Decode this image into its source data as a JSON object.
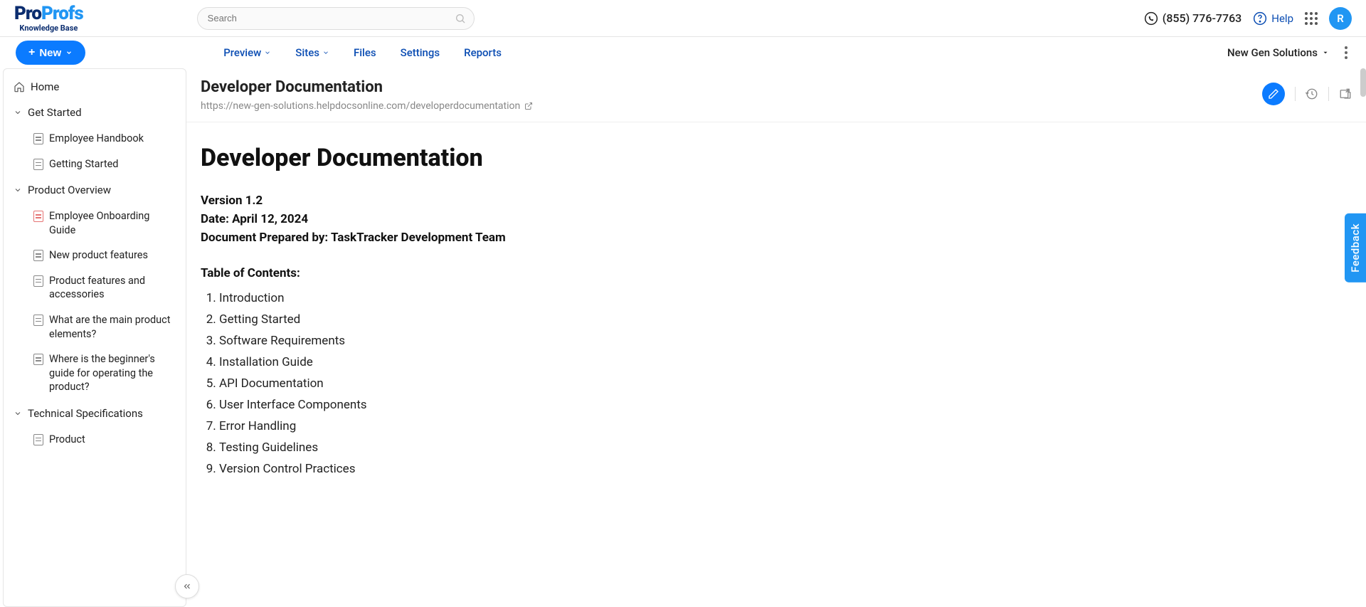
{
  "header": {
    "logo_pro": "Pro",
    "logo_profs": "Profs",
    "logo_sub": "Knowledge Base",
    "search_placeholder": "Search",
    "phone": "(855) 776-7763",
    "help": "Help",
    "avatar_initial": "R"
  },
  "subbar": {
    "new_label": "New",
    "tabs": [
      "Preview",
      "Sites",
      "Files",
      "Settings",
      "Reports"
    ],
    "site_name": "New Gen Solutions"
  },
  "sidebar": {
    "home": "Home",
    "sections": [
      {
        "label": "Get Started",
        "children": [
          {
            "label": "Employee Handbook",
            "active": false
          },
          {
            "label": "Getting Started",
            "active": false
          }
        ]
      },
      {
        "label": "Product Overview",
        "children": [
          {
            "label": "Employee Onboarding Guide",
            "active": true
          },
          {
            "label": "New product features",
            "active": false
          },
          {
            "label": "Product features and accessories",
            "active": false
          },
          {
            "label": "What are the main product elements?",
            "active": false
          },
          {
            "label": "Where is the beginner's guide for operating the product?",
            "active": false
          }
        ]
      },
      {
        "label": "Technical Specifications",
        "children": [
          {
            "label": "Product",
            "active": false
          }
        ]
      }
    ]
  },
  "page": {
    "title": "Developer Documentation",
    "url": "https://new-gen-solutions.helpdocsonline.com/developerdocumentation",
    "h1": "Developer Documentation",
    "version": "Version 1.2",
    "date_label": "Date: April 12, 2024",
    "prepared_by": "Document Prepared by: TaskTracker Development Team",
    "toc_title": "Table of Contents:",
    "toc": [
      "Introduction",
      "Getting Started",
      "Software Requirements",
      "Installation Guide",
      "API Documentation",
      "User Interface Components",
      "Error Handling",
      "Testing Guidelines",
      "Version Control Practices"
    ]
  },
  "feedback_label": "Feedback"
}
